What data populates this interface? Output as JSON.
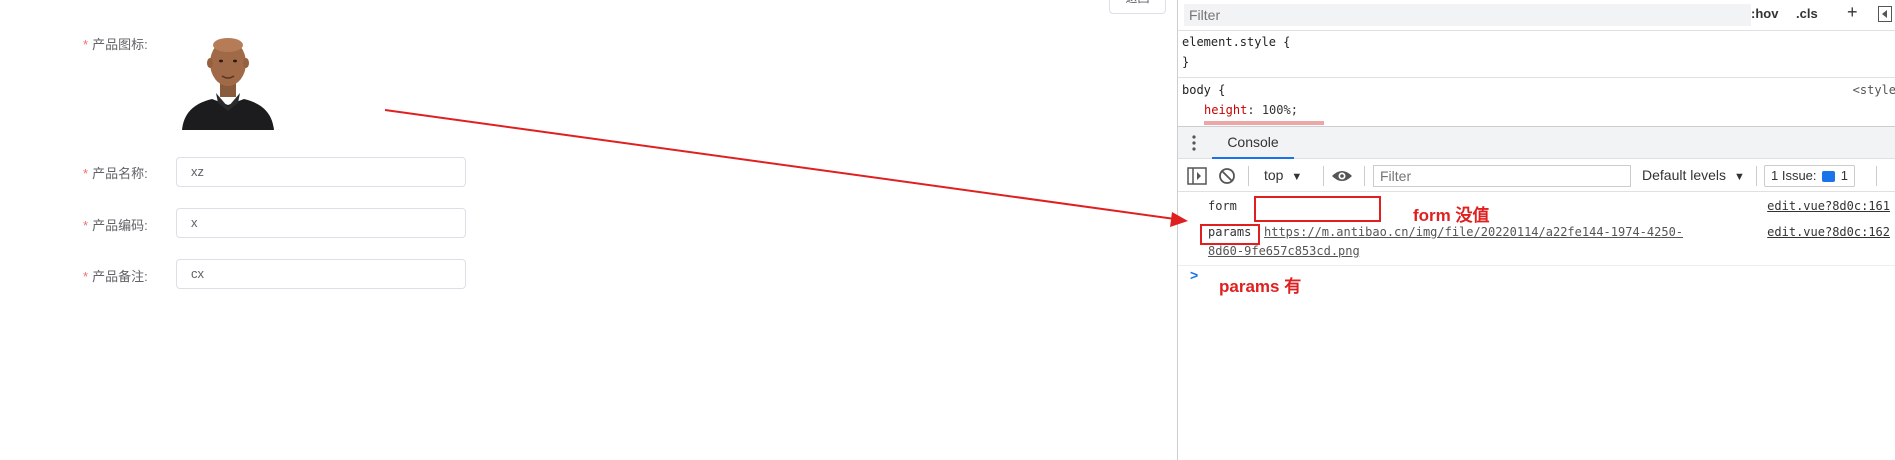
{
  "app": {
    "top_button_label": "返回",
    "fields": [
      {
        "label": "产品图标:",
        "required_mark": "*"
      },
      {
        "label": "产品名称:",
        "required_mark": "*",
        "value": "xz"
      },
      {
        "label": "产品编码:",
        "required_mark": "*",
        "value": "x"
      },
      {
        "label": "产品备注:",
        "required_mark": "*",
        "value": "cx"
      }
    ]
  },
  "devtools": {
    "styles": {
      "filter_placeholder": "Filter",
      "hov_label": ":hov",
      "cls_label": ".cls",
      "plus_label": "+",
      "element_style_open": "element.style {",
      "element_style_close": "}",
      "body_selector": "body {",
      "body_source": "<style",
      "prop_name": "height",
      "prop_value": "100%;"
    },
    "drawer": {
      "console_tab": "Console"
    },
    "toolbar": {
      "context": "top",
      "filter_placeholder": "Filter",
      "levels": "Default levels",
      "issues_label": "1 Issue:",
      "issues_count": "1"
    },
    "logs": [
      {
        "text": "form",
        "source": "edit.vue?8d0c:161"
      },
      {
        "text": "params",
        "url_line1": "https://m.antibao.cn/img/file/20220114/a22fe144-1974-4250-",
        "url_line2": "8d60-9fe657c853cd.png",
        "source": "edit.vue?8d0c:162"
      }
    ],
    "prompt_chevron": ">"
  },
  "annotations": {
    "form_note": "form 没值",
    "params_note": "params 有",
    "arrow_color": "#e02020"
  }
}
